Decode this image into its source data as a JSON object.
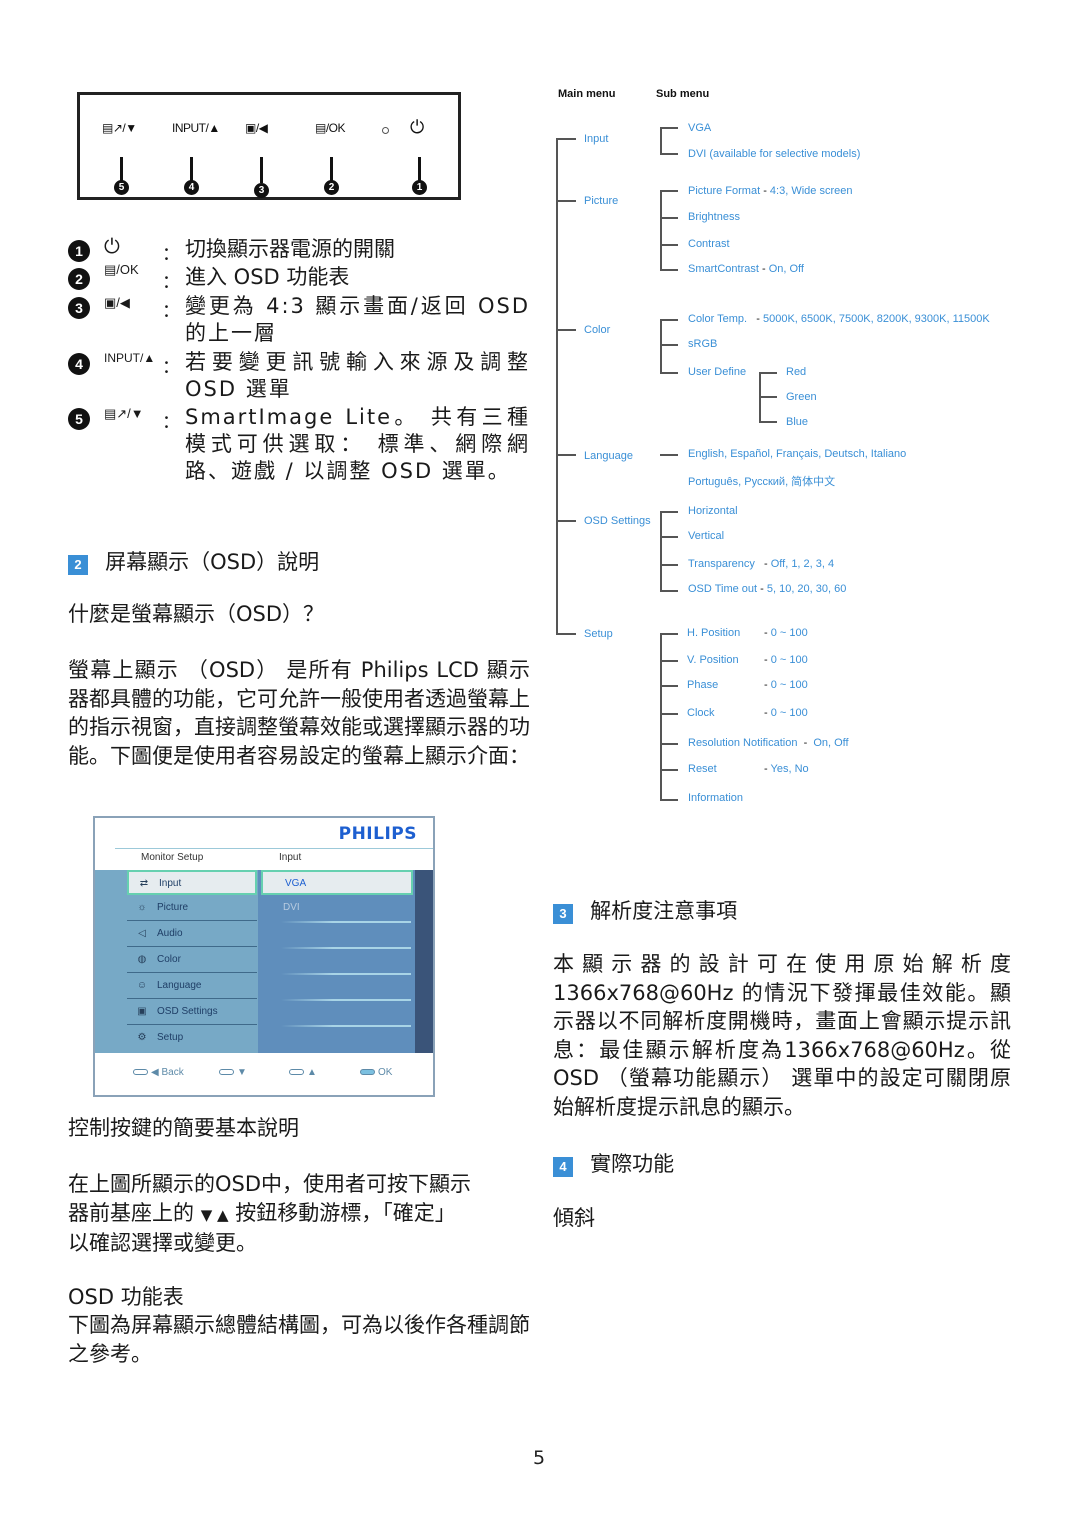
{
  "panel": {
    "buttons": [
      {
        "label": "▤↗/▼",
        "number": "5",
        "icon": "smartimage-down-icon"
      },
      {
        "label": "INPUT/▲",
        "number": "4",
        "icon": "input-up-icon"
      },
      {
        "label": "▣/◀",
        "number": "3",
        "icon": "aspect-left-icon"
      },
      {
        "label": "▤/OK",
        "number": "2",
        "icon": "menu-ok-icon"
      },
      {
        "label": "⏻",
        "number": "1",
        "icon": "power-icon"
      }
    ]
  },
  "legend": [
    {
      "number": "1",
      "key": "⏻",
      "colon": "：",
      "text": "切換顯示器電源的開關"
    },
    {
      "number": "2",
      "key": "▤/OK",
      "colon": "：",
      "text": "進入 OSD 功能表"
    },
    {
      "number": "3",
      "key": "▣/◀",
      "colon": "：",
      "text": "變更為 4:3 顯示畫面/返回 OSD 的上一層"
    },
    {
      "number": "4",
      "key": "INPUT/▲",
      "colon": "：",
      "text": "若要變更訊號輸入來源及調整 OSD 選單"
    },
    {
      "number": "5",
      "key": "▤↗/▼",
      "colon": "：",
      "text": "SmartImage Lite。 共有三種模式可供選取： 標準、網際網路、遊戲 / 以調整 OSD 選單。"
    }
  ],
  "section2": {
    "badge": "2",
    "title": "屏幕顯示（OSD）說明",
    "question": "什麼是螢幕顯示（OSD）？",
    "para": "螢幕上顯示 （OSD） 是所有 Philips LCD 顯示器都具體的功能，它可允許一般使用者透過螢幕上的指示視窗，直接調整螢幕效能或選擇顯示器的功能。下圖便是使用者容易設定的螢幕上顯示介面："
  },
  "osd_screen": {
    "brand": "PHILIPS",
    "header_left": "Monitor Setup",
    "header_right": "Input",
    "menu": [
      {
        "label": "Input",
        "icon": "input-icon",
        "glyph": "⇄"
      },
      {
        "label": "Picture",
        "icon": "picture-icon",
        "glyph": "☼"
      },
      {
        "label": "Audio",
        "icon": "audio-icon",
        "glyph": "◁"
      },
      {
        "label": "Color",
        "icon": "color-icon",
        "glyph": "◍"
      },
      {
        "label": "Language",
        "icon": "language-icon",
        "glyph": "☺"
      },
      {
        "label": "OSD Settings",
        "icon": "osd-settings-icon",
        "glyph": "▣"
      },
      {
        "label": "Setup",
        "icon": "setup-icon",
        "glyph": "⚙"
      }
    ],
    "selected_menu": "Input",
    "submenu": [
      "VGA",
      "DVI"
    ],
    "selected_sub": "VGA",
    "footer": [
      {
        "label": "Back",
        "arrow": "◀"
      },
      {
        "label": "",
        "arrow": "▼"
      },
      {
        "label": "",
        "arrow": "▲"
      },
      {
        "label": "OK",
        "arrow": ""
      }
    ]
  },
  "controls": {
    "title": "控制按鍵的簡要基本說明",
    "para_1": "在上圖所顯示的OSD中，使用者可按下顯示",
    "para_2a": "器前基座上的",
    "para_arrows": "▼ ▲",
    "para_2b": "按鈕移動游標，「確定」",
    "para_3": "以確認選擇或變更。"
  },
  "osd_table": {
    "title": "OSD 功能表",
    "para": "下圖為屏幕顯示總體結構圖，可為以後作各種調節之參考。"
  },
  "tree": {
    "main_header": "Main menu",
    "sub_header": "Sub menu",
    "main": [
      "Input",
      "Picture",
      "Color",
      "Language",
      "OSD Settings",
      "Setup"
    ],
    "input": [
      "VGA",
      "DVI (available for selective models)"
    ],
    "picture": [
      {
        "name": "Picture Format",
        "sep": " - ",
        "values": "4:3, Wide screen"
      },
      {
        "name": "Brightness",
        "sep": "",
        "values": ""
      },
      {
        "name": "Contrast",
        "sep": "",
        "values": ""
      },
      {
        "name": "SmartContrast",
        "sep": " - ",
        "values": "On, Off"
      }
    ],
    "color": [
      {
        "name": "Color Temp.",
        "sep": "   - ",
        "values": "5000K, 6500K, 7500K, 8200K, 9300K, 11500K"
      },
      {
        "name": "sRGB",
        "sep": "",
        "values": ""
      },
      {
        "name": "User Define",
        "sep": "",
        "values": ""
      }
    ],
    "user_define": [
      "Red",
      "Green",
      "Blue"
    ],
    "language": [
      "English, Español, Français, Deutsch, Italiano",
      "Português, Русский, 简体中文"
    ],
    "osd_settings": [
      {
        "name": "Horizontal",
        "sep": "",
        "values": ""
      },
      {
        "name": "Vertical",
        "sep": "",
        "values": ""
      },
      {
        "name": "Transparency",
        "sep": "   - ",
        "values": "Off, 1, 2, 3, 4"
      },
      {
        "name": "OSD Time out",
        "sep": " - ",
        "values": "5, 10, 20, 30, 60"
      }
    ],
    "setup": [
      {
        "name": "H. Position",
        "sep": " - ",
        "values": "0 ~ 100"
      },
      {
        "name": "V. Position",
        "sep": " - ",
        "values": "0 ~ 100"
      },
      {
        "name": "Phase",
        "sep": " - ",
        "values": "0 ~ 100"
      },
      {
        "name": "Clock",
        "sep": " - ",
        "values": "0 ~ 100"
      },
      {
        "name": "Resolution Notification",
        "sep": "  -  ",
        "values": "On, Off"
      },
      {
        "name": "Reset",
        "sep": " - ",
        "values": "Yes, No"
      },
      {
        "name": "Information",
        "sep": "",
        "values": ""
      }
    ]
  },
  "section3": {
    "badge": "3",
    "title": "解析度注意事項",
    "para": "本顯示器的設計可在使用原始解析度 1366x768@60Hz 的情況下發揮最佳效能。顯示器以不同解析度開機時，畫面上會顯示提示訊息：最佳顯示解析度為1366x768@60Hz。從OSD （螢幕功能顯示） 選單中的設定可關閉原始解析度提示訊息的顯示。"
  },
  "section4": {
    "badge": "4",
    "title": "實際功能",
    "sub": "傾斜"
  },
  "page_number": "5"
}
